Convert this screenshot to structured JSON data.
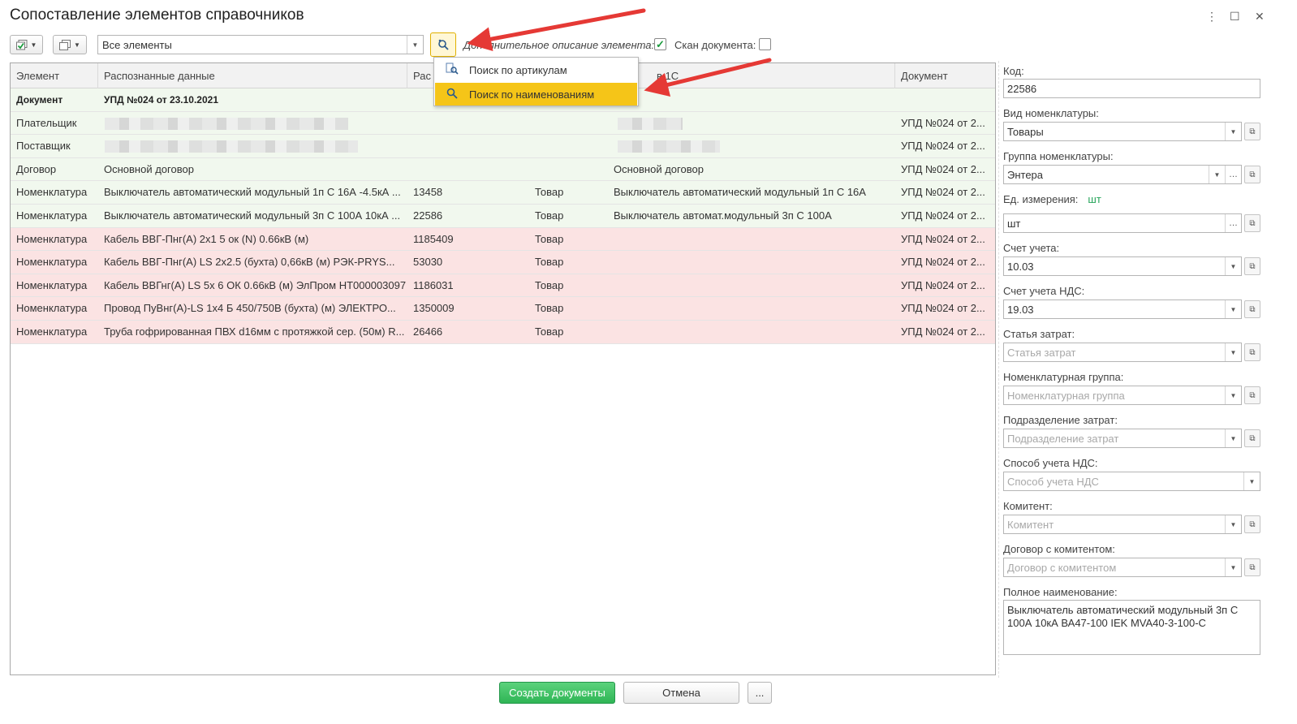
{
  "window": {
    "title": "Сопоставление элементов справочников",
    "menu_icon": "⋮",
    "maximize_icon": "☐",
    "close_icon": "✕"
  },
  "toolbar": {
    "filter_value": "Все элементы",
    "extra_description_label": "Дополнительное описание элемента:",
    "extra_description_checked": true,
    "scan_label": "Скан документа:",
    "scan_checked": false
  },
  "search_menu": {
    "items": [
      {
        "label": "Поиск по артикулам",
        "icon": "article-search-icon"
      },
      {
        "label": "Поиск по наименованиям",
        "icon": "magnifier-icon",
        "highlighted": true
      }
    ]
  },
  "table": {
    "columns": [
      "Элемент",
      "Распознанные данные",
      "Рас",
      "",
      "в 1С",
      "Документ"
    ],
    "rows": [
      {
        "element": "Документ",
        "recognized": "УПД №024 от 23.10.2021",
        "code": "",
        "kind": "",
        "in1c": "",
        "document": "",
        "status": "header"
      },
      {
        "element": "Плательщик",
        "recognized": "",
        "code": "",
        "kind": "",
        "in1c": "",
        "document": "УПД №024 от 2...",
        "status": "ok",
        "redacted": true
      },
      {
        "element": "Поставщик",
        "recognized": "",
        "code": "",
        "kind": "",
        "in1c": "",
        "document": "УПД №024 от 2...",
        "status": "ok",
        "redacted": true
      },
      {
        "element": "Договор",
        "recognized": "Основной договор",
        "code": "",
        "kind": "",
        "in1c": "Основной договор",
        "document": "УПД №024 от 2...",
        "status": "ok"
      },
      {
        "element": "Номенклатура",
        "recognized": "Выключатель автоматический модульный 1п С 16А -4.5кА ...",
        "code": "13458",
        "kind": "Товар",
        "in1c": "Выключатель автоматический модульный 1п С 16А",
        "document": "УПД №024 от 2...",
        "status": "ok"
      },
      {
        "element": "Номенклатура",
        "recognized": "Выключатель автоматический модульный 3п С 100А 10кА ...",
        "code": "22586",
        "kind": "Товар",
        "in1c": "Выключатель автомат.модульный 3п С 100А",
        "document": "УПД №024 от 2...",
        "status": "ok"
      },
      {
        "element": "Номенклатура",
        "recognized": "Кабель ВВГ-Пнг(А) 2х1 5 ок (N) 0.66кВ (м)",
        "code": "1185409",
        "kind": "Товар",
        "in1c": "",
        "document": "УПД №024 от 2...",
        "status": "missing"
      },
      {
        "element": "Номенклатура",
        "recognized": "Кабель ВВГ-Пнг(А) LS 2х2.5 (бухта) 0,66кВ (м) РЭК-PRYS...",
        "code": "53030",
        "kind": "Товар",
        "in1c": "",
        "document": "УПД №024 от 2...",
        "status": "missing"
      },
      {
        "element": "Номенклатура",
        "recognized": "Кабель ВВГнг(А) LS 5х 6 ОК 0.66кВ (м) ЭлПром НТ000003097",
        "code": "1186031",
        "kind": "Товар",
        "in1c": "",
        "document": "УПД №024 от 2...",
        "status": "missing"
      },
      {
        "element": "Номенклатура",
        "recognized": "Провод ПуВнг(А)-LS 1х4 Б 450/750В (бухта) (м) ЭЛЕКТРО...",
        "code": "1350009",
        "kind": "Товар",
        "in1c": "",
        "document": "УПД №024 от 2...",
        "status": "missing"
      },
      {
        "element": "Номенклатура",
        "recognized": "Труба гофрированная ПВХ d16мм с протяжкой сер. (50м) R...",
        "code": "26466",
        "kind": "Товар",
        "in1c": "",
        "document": "УПД №024 от 2...",
        "status": "missing"
      }
    ]
  },
  "details": {
    "code_label": "Код:",
    "code_value": "22586",
    "kind_label": "Вид номенклатуры:",
    "kind_value": "Товары",
    "group_label": "Группа номенклатуры:",
    "group_value": "Энтера",
    "unit_label": "Ед. измерения:",
    "unit_hint": "шт",
    "unit_value": "шт",
    "account_label": "Счет учета:",
    "account_value": "10.03",
    "vat_account_label": "Счет учета НДС:",
    "vat_account_value": "19.03",
    "cost_item_label": "Статья затрат:",
    "cost_item_placeholder": "Статья затрат",
    "nom_group_label": "Номенклатурная группа:",
    "nom_group_placeholder": "Номенклатурная группа",
    "cost_dept_label": "Подразделение затрат:",
    "cost_dept_placeholder": "Подразделение затрат",
    "vat_method_label": "Способ учета НДС:",
    "vat_method_placeholder": "Способ учета НДС",
    "committent_label": "Комитент:",
    "committent_placeholder": "Комитент",
    "committent_contract_label": "Договор с комитентом:",
    "committent_contract_placeholder": "Договор с комитентом",
    "full_name_label": "Полное наименование:",
    "full_name_value": "Выключатель автоматический модульный 3п С 100А 10кА ВА47-100 IEK MVA40-3-100-C"
  },
  "footer": {
    "create_label": "Создать документы",
    "cancel_label": "Отмена",
    "more_label": "..."
  },
  "colors": {
    "accent_yellow": "#f5c518",
    "row_ok": "#f1f8ee",
    "row_missing": "#fbe3e3",
    "primary_green": "#2fb555",
    "annotation_arrow": "#e53935"
  }
}
